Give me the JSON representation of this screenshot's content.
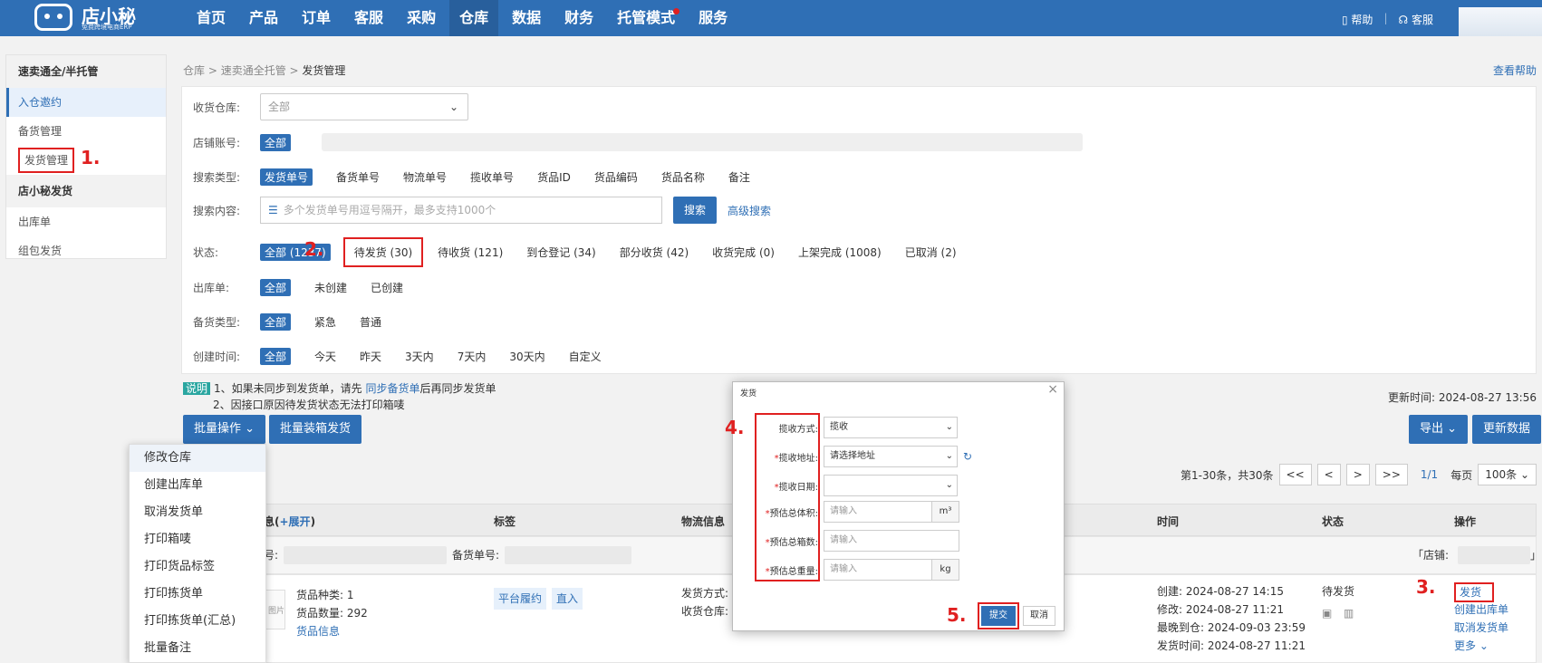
{
  "brand": {
    "name": "店小秘",
    "tagline": "免费跨境电商ERP"
  },
  "nav": [
    "首页",
    "产品",
    "订单",
    "客服",
    "采购",
    "仓库",
    "数据",
    "财务",
    "托管模式",
    "服务"
  ],
  "top_right": {
    "help": "帮助",
    "service": "客服"
  },
  "sidebar": {
    "group1": "速卖通全/半托管",
    "items1": [
      "入仓邀约",
      "备货管理",
      "发货管理"
    ],
    "group2": "店小秘发货",
    "items2": [
      "出库单",
      "组包发货"
    ]
  },
  "breadcrumb": {
    "a": "仓库",
    "b": "速卖通全托管",
    "c": "发货管理",
    "sep": " > "
  },
  "help_link": "查看帮助",
  "filters": {
    "warehouse": {
      "label": "收货仓库:",
      "value": "全部"
    },
    "store": {
      "label": "店铺账号:",
      "value": "全部"
    },
    "search_type": {
      "label": "搜索类型:",
      "options": [
        "发货单号",
        "备货单号",
        "物流单号",
        "揽收单号",
        "货品ID",
        "货品编码",
        "货品名称",
        "备注"
      ]
    },
    "search_content": {
      "label": "搜索内容:",
      "placeholder": "多个发货单号用逗号隔开，最多支持1000个",
      "button": "搜索",
      "advanced": "高级搜索"
    },
    "status": {
      "label": "状态:",
      "options": [
        "全部 (1237)",
        "待发货 (30)",
        "待收货 (121)",
        "到仓登记 (34)",
        "部分收货 (42)",
        "收货完成 (0)",
        "上架完成 (1008)",
        "已取消 (2)"
      ]
    },
    "outbound": {
      "label": "出库单:",
      "options": [
        "全部",
        "未创建",
        "已创建"
      ]
    },
    "stock_type": {
      "label": "备货类型:",
      "options": [
        "全部",
        "紧急",
        "普通"
      ]
    },
    "created": {
      "label": "创建时间:",
      "options": [
        "全部",
        "今天",
        "昨天",
        "3天内",
        "7天内",
        "30天内",
        "自定义"
      ]
    }
  },
  "annotations": [
    "1.",
    "2.",
    "3.",
    "4.",
    "5."
  ],
  "notice": {
    "tag": "说明",
    "line1_pre": "1、如果未同步到发货单，请先 ",
    "line1_link": "同步备货单",
    "line1_post": "后再同步发货单",
    "line2": "2、因接口原因待发货状态无法打印箱唛"
  },
  "toolbar": {
    "batch": "批量操作",
    "pack_ship": "批量装箱发货",
    "export": "导出",
    "update": "更新数据",
    "updated_at": "更新时间: 2024-08-27 13:56"
  },
  "pagination": {
    "summary": "第1-30条，共30条",
    "first": "<<",
    "prev": "<",
    "next": ">",
    "last": ">>",
    "current": "1/1",
    "per_page_label": "每页",
    "per_page": "100条"
  },
  "batch_menu": [
    "修改仓库",
    "创建出库单",
    "取消发货单",
    "打印箱唛",
    "打印货品标签",
    "打印拣货单",
    "打印拣货单(汇总)",
    "批量备注"
  ],
  "table": {
    "headers": {
      "info_suffix": "息(",
      "expand": "+展开",
      "info_close": ")",
      "tags": "标签",
      "logistics": "物流信息",
      "time": "时间",
      "status": "状态",
      "ops": "操作"
    },
    "sub": {
      "ship_no_label": "号:",
      "stock_no_label": "备货单号:",
      "store_label": "「店铺:",
      "store_close": "」"
    },
    "row": {
      "thumb": "图片",
      "kinds": "货品种类: 1",
      "qty": "货品数量: 292",
      "goods_info": "货品信息",
      "tag1": "平台履约",
      "tag2": "直入",
      "ship_method": "发货方式:",
      "recv_wh": "收货仓库:",
      "created": "创建: 2024-08-27 14:15",
      "modified": "修改: 2024-08-27 11:21",
      "latest": "最晚到仓: 2024-09-03 23:59",
      "shipped": "发货时间: 2024-08-27 11:21",
      "status": "待发货",
      "op_ship": "发货",
      "op_create": "创建出库单",
      "op_cancel": "取消发货单",
      "op_more": "更多"
    }
  },
  "modal": {
    "title": "发货",
    "pickup_method": {
      "label": "揽收方式:",
      "value": "揽收"
    },
    "pickup_address": {
      "label": "揽收地址:",
      "value": "请选择地址"
    },
    "pickup_date": {
      "label": "揽收日期:",
      "value": ""
    },
    "volume": {
      "label": "预估总体积:",
      "placeholder": "请输入",
      "unit": "m³"
    },
    "boxes": {
      "label": "预估总箱数:",
      "placeholder": "请输入"
    },
    "weight": {
      "label": "预估总重量:",
      "placeholder": "请输入",
      "unit": "kg"
    },
    "submit": "提交",
    "cancel": "取消"
  }
}
